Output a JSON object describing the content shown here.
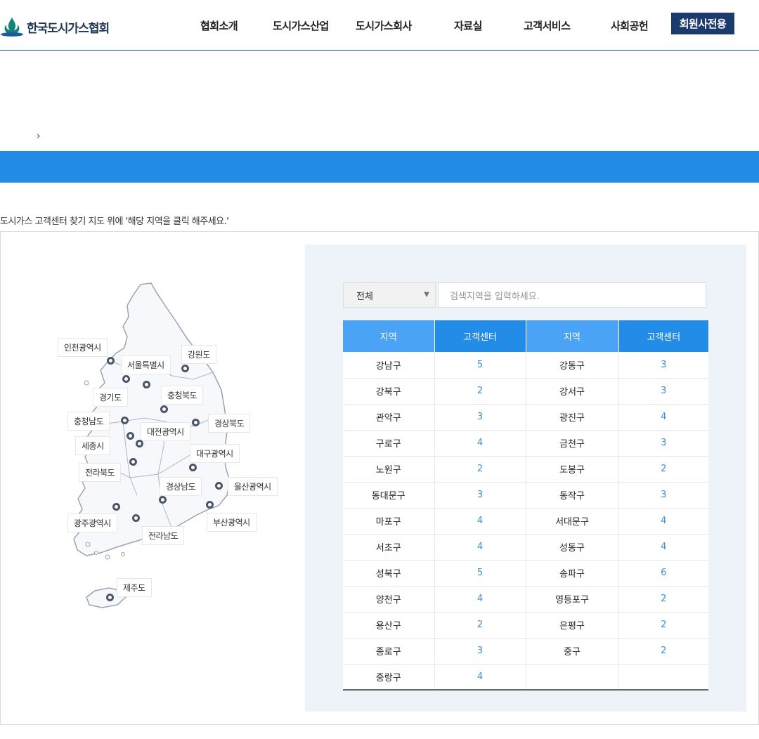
{
  "header": {
    "logo_text": "한국도시가스협회",
    "nav": [
      "협회소개",
      "도시가스산업",
      "도시가스회사",
      "자료실",
      "고객서비스",
      "사회공헌"
    ],
    "member_button": "회원사전용"
  },
  "breadcrumb": {
    "separator": "›"
  },
  "instruction": "도시가스 고객센터 찾기 지도 위에 '해당 지역을 클릭 해주세요.'",
  "map": {
    "regions": [
      "인천광역시",
      "서울특별시",
      "강원도",
      "경기도",
      "충청북도",
      "충청남도",
      "대전광역시",
      "경상북도",
      "세종시",
      "대구광역시",
      "전라북도",
      "경상남도",
      "울산광역시",
      "광주광역시",
      "부산광역시",
      "전라남도",
      "제주도"
    ]
  },
  "search": {
    "select_value": "전체",
    "placeholder": "검색지역을 입력하세요."
  },
  "table": {
    "headers": [
      "지역",
      "고객센터",
      "지역",
      "고객센터"
    ],
    "rows": [
      [
        "강남구",
        "5",
        "강동구",
        "3"
      ],
      [
        "강북구",
        "2",
        "강서구",
        "3"
      ],
      [
        "관악구",
        "3",
        "광진구",
        "4"
      ],
      [
        "구로구",
        "4",
        "금천구",
        "3"
      ],
      [
        "노원구",
        "2",
        "도봉구",
        "2"
      ],
      [
        "동대문구",
        "3",
        "동작구",
        "3"
      ],
      [
        "마포구",
        "4",
        "서대문구",
        "4"
      ],
      [
        "서초구",
        "4",
        "성동구",
        "4"
      ],
      [
        "성북구",
        "5",
        "송파구",
        "6"
      ],
      [
        "양천구",
        "4",
        "영등포구",
        "2"
      ],
      [
        "용산구",
        "2",
        "은평구",
        "2"
      ],
      [
        "종로구",
        "3",
        "중구",
        "2"
      ],
      [
        "중랑구",
        "4",
        "",
        ""
      ]
    ]
  },
  "colors": {
    "accent": "#238ce6",
    "header_light": "#4aa3f5",
    "member_button": "#1c3a6e",
    "count_text": "#3a8fd9"
  }
}
